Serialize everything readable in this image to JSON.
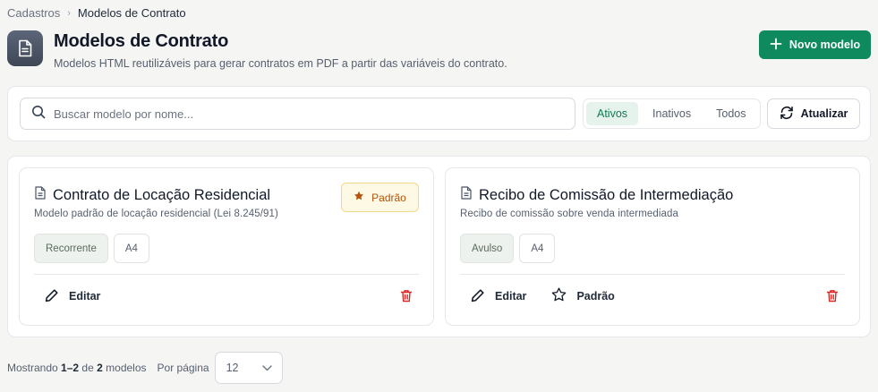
{
  "breadcrumb": {
    "parent": "Cadastros",
    "separator": "›",
    "current": "Modelos de Contrato"
  },
  "header": {
    "icon": "document-icon",
    "title": "Modelos de Contrato",
    "subtitle": "Modelos HTML reutilizáveis para gerar contratos em PDF a partir das variáveis do contrato.",
    "new_button": "Novo modelo"
  },
  "toolbar": {
    "search_placeholder": "Buscar modelo por nome...",
    "search_value": "",
    "filters": [
      "Ativos",
      "Inativos",
      "Todos"
    ],
    "active_filter": "Ativos",
    "refresh_button": "Atualizar"
  },
  "templates": [
    {
      "name": "Contrato de Locação Residencial",
      "description": "Modelo padrão de locação residencial (Lei 8.245/91)",
      "type": "Recorrente",
      "paper": "A4",
      "default_badge": "Padrão",
      "actions": [
        "Editar"
      ]
    },
    {
      "name": "Recibo de Comissão de Intermediação",
      "description": "Recibo de comissão sobre venda intermediada",
      "type": "Avulso",
      "paper": "A4",
      "actions": [
        "Editar",
        "Padrão"
      ]
    }
  ],
  "footer": {
    "showing_prefix": "Mostrando",
    "range": "1–2",
    "of": "de",
    "total": "2",
    "unit": "modelos",
    "per_page_label": "Por página",
    "per_page_value": "12"
  },
  "colors": {
    "primary": "#0f8a5f",
    "active_filter_bg": "#e6f3ec",
    "default_badge_bg": "#fef9e4",
    "default_badge_text": "#b45309",
    "delete": "#dc2626"
  }
}
